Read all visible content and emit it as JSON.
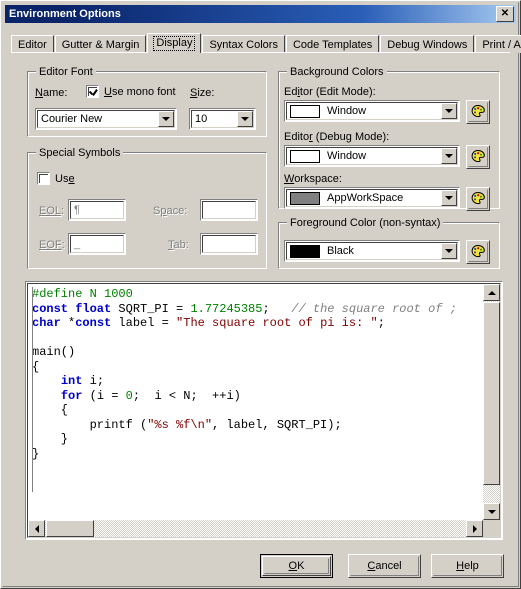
{
  "window": {
    "title": "Environment Options",
    "close_label": "✕"
  },
  "tabs": [
    {
      "label": "Editor",
      "selected": false
    },
    {
      "label": "Gutter & Margin",
      "selected": false
    },
    {
      "label": "Display",
      "selected": true
    },
    {
      "label": "Syntax Colors",
      "selected": false
    },
    {
      "label": "Code Templates",
      "selected": false
    },
    {
      "label": "Debug Windows",
      "selected": false
    },
    {
      "label": "Print / Alerts",
      "selected": false
    }
  ],
  "editor_font": {
    "group_title": "Editor Font",
    "name_label": "Name:",
    "use_mono_label": "Use mono font",
    "use_mono_checked": true,
    "size_label": "Size:",
    "font_value": "Courier New",
    "size_value": "10"
  },
  "special_symbols": {
    "group_title": "Special Symbols",
    "use_label": "Use",
    "use_checked": false,
    "eol_label": "EOL:",
    "eol_value": "¶",
    "space_label": "Space:",
    "space_value": "",
    "eof_label": "EOF:",
    "eof_value": "_",
    "tab_label": "Tab:",
    "tab_value": ""
  },
  "background_colors": {
    "group_title": "Background Colors",
    "edit_mode_label": "Editor (Edit Mode):",
    "edit_mode_value": "Window",
    "edit_mode_swatch": "#ffffff",
    "debug_mode_label": "Editor (Debug Mode):",
    "debug_mode_value": "Window",
    "debug_mode_swatch": "#ffffff",
    "workspace_label": "Workspace:",
    "workspace_value": "AppWorkSpace",
    "workspace_swatch": "#808080",
    "palette_button_name": "palette-icon"
  },
  "foreground_color": {
    "group_title": "Foreground Color (non-syntax)",
    "value": "Black",
    "swatch": "#000000"
  },
  "code_preview": {
    "lines": [
      [
        {
          "t": "#define N 1000",
          "c": "pre"
        }
      ],
      [
        {
          "t": "const float",
          "c": "k"
        },
        {
          "t": " SQRT_PI = ",
          "c": ""
        },
        {
          "t": "1.77245385",
          "c": "num"
        },
        {
          "t": ";   ",
          "c": ""
        },
        {
          "t": "// the square root of ;",
          "c": "cmt"
        }
      ],
      [
        {
          "t": "char",
          "c": "k"
        },
        {
          "t": " *",
          "c": ""
        },
        {
          "t": "const",
          "c": "k"
        },
        {
          "t": " label = ",
          "c": ""
        },
        {
          "t": "\"The square root of pi is: \"",
          "c": "str"
        },
        {
          "t": ";",
          "c": ""
        }
      ],
      [],
      [
        {
          "t": "main()",
          "c": ""
        }
      ],
      [
        {
          "t": "{",
          "c": ""
        }
      ],
      [
        {
          "t": "    ",
          "c": ""
        },
        {
          "t": "int",
          "c": "k"
        },
        {
          "t": " i;",
          "c": ""
        }
      ],
      [
        {
          "t": "    ",
          "c": ""
        },
        {
          "t": "for",
          "c": "k"
        },
        {
          "t": " (i = ",
          "c": ""
        },
        {
          "t": "0",
          "c": "num"
        },
        {
          "t": ";  i < N;  ++i)",
          "c": ""
        }
      ],
      [
        {
          "t": "    {",
          "c": ""
        }
      ],
      [
        {
          "t": "        printf (",
          "c": ""
        },
        {
          "t": "\"%s %f\\n\"",
          "c": "str"
        },
        {
          "t": ", label, SQRT_PI);",
          "c": ""
        }
      ],
      [
        {
          "t": "    }",
          "c": ""
        }
      ],
      [
        {
          "t": "}",
          "c": ""
        }
      ]
    ],
    "colors": {
      "keyword": "#0000cd",
      "number": "#008000",
      "string": "#800000",
      "preprocessor": "#008000",
      "comment": "#808080",
      "background": "#ffffff"
    }
  },
  "buttons": {
    "ok": "OK",
    "cancel": "Cancel",
    "help": "Help"
  }
}
